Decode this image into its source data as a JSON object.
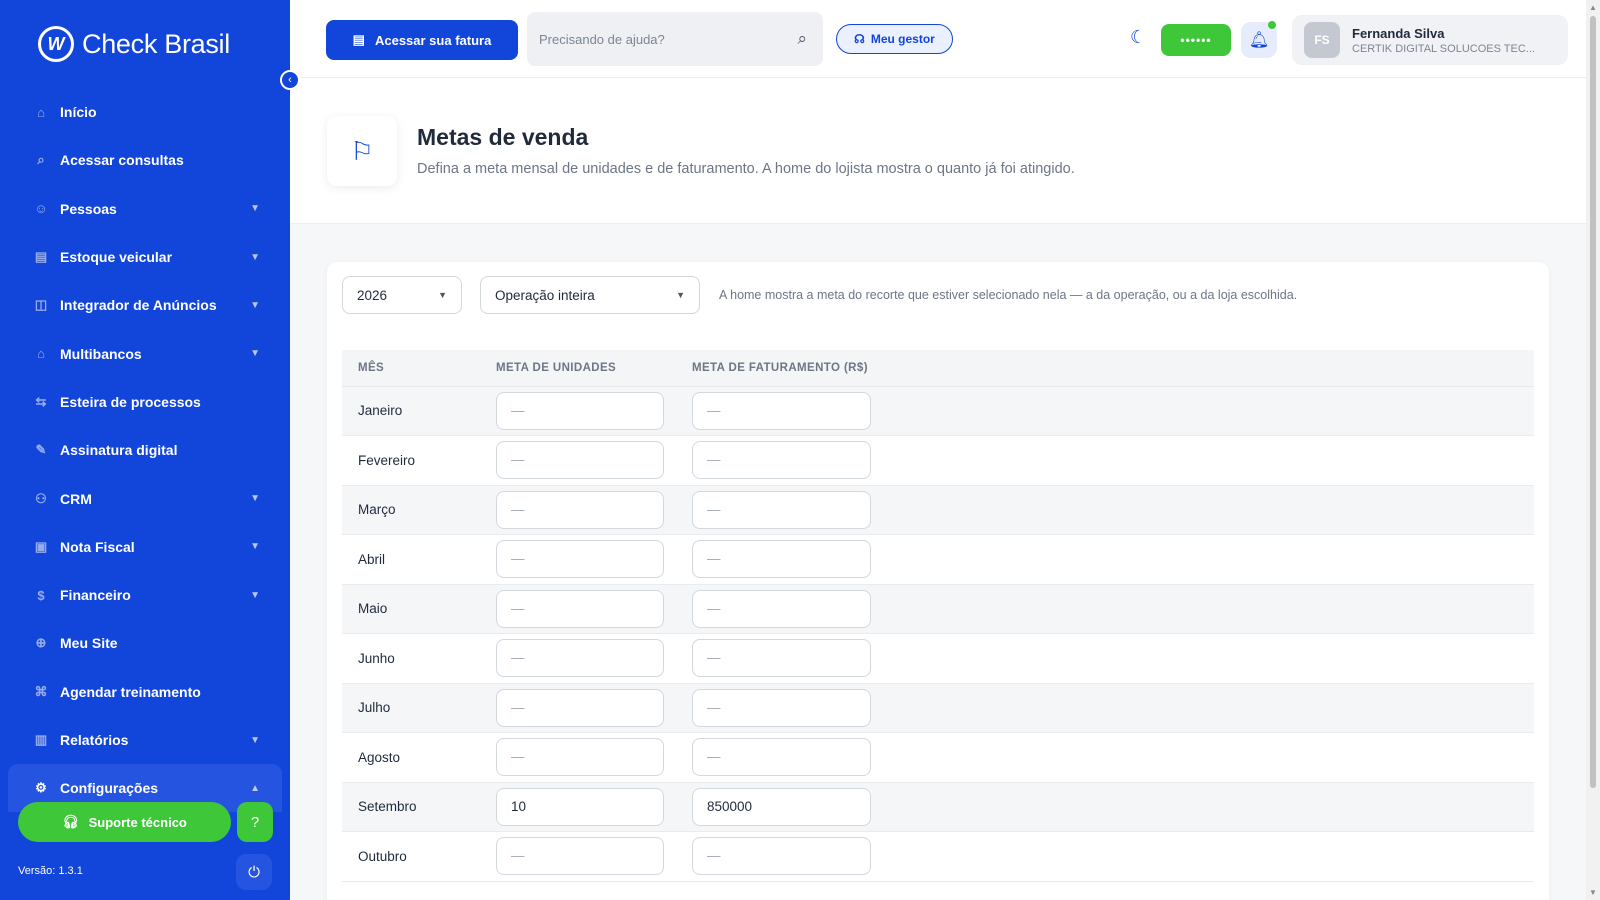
{
  "brand": {
    "logo": "W",
    "name": "Check Brasil"
  },
  "sidebar": {
    "items": [
      {
        "label": "Início",
        "icon": "⌂",
        "icon_name": "home-icon",
        "expandable": false
      },
      {
        "label": "Acessar consultas",
        "icon": "⌕",
        "icon_name": "search-icon",
        "expandable": false
      },
      {
        "label": "Pessoas",
        "icon": "☺",
        "icon_name": "people-icon",
        "expandable": true
      },
      {
        "label": "Estoque veicular",
        "icon": "▤",
        "icon_name": "vehicle-stock-icon",
        "expandable": true
      },
      {
        "label": "Integrador de Anúncios",
        "icon": "◫",
        "icon_name": "ads-integrator-icon",
        "expandable": true
      },
      {
        "label": "Multibancos",
        "icon": "⌂",
        "icon_name": "bank-icon",
        "expandable": true
      },
      {
        "label": "Esteira de processos",
        "icon": "⇆",
        "icon_name": "process-pipeline-icon",
        "expandable": false
      },
      {
        "label": "Assinatura digital",
        "icon": "✎",
        "icon_name": "signature-icon",
        "expandable": false
      },
      {
        "label": "CRM",
        "icon": "⚇",
        "icon_name": "crm-icon",
        "expandable": true
      },
      {
        "label": "Nota Fiscal",
        "icon": "▣",
        "icon_name": "invoice-icon",
        "expandable": true
      },
      {
        "label": "Financeiro",
        "icon": "$",
        "icon_name": "finance-icon",
        "expandable": true
      },
      {
        "label": "Meu Site",
        "icon": "⊕",
        "icon_name": "globe-icon",
        "expandable": false
      },
      {
        "label": "Agendar treinamento",
        "icon": "⌘",
        "icon_name": "training-icon",
        "expandable": false
      },
      {
        "label": "Relatórios",
        "icon": "▥",
        "icon_name": "reports-icon",
        "expandable": true
      },
      {
        "label": "Configurações",
        "icon": "⚙",
        "icon_name": "gear-icon",
        "expandable": true,
        "expanded": true
      }
    ],
    "support_label": "Suporte técnico",
    "version": "Versão: 1.3.1"
  },
  "topbar": {
    "fatura_label": "Acessar sua fatura",
    "help_placeholder": "Precisando de ajuda?",
    "gestor_label": "Meu gestor",
    "masked_value": "••••••",
    "user": {
      "initials": "FS",
      "name": "Fernanda Silva",
      "company": "CERTIK DIGITAL SOLUCOES TEC..."
    }
  },
  "header": {
    "title": "Metas de venda",
    "subtitle": "Defina a meta mensal de unidades e de faturamento. A home do lojista mostra o quanto já foi atingido."
  },
  "filters": {
    "year": "2026",
    "scope": "Operação inteira",
    "note": "A home mostra a meta do recorte que estiver selecionado nela — a da operação, ou a da loja escolhida."
  },
  "table": {
    "headers": {
      "month": "MÊS",
      "units": "META DE UNIDADES",
      "revenue": "META DE FATURAMENTO (R$)"
    },
    "placeholder": "—",
    "rows": [
      {
        "month": "Janeiro",
        "units": "",
        "revenue": ""
      },
      {
        "month": "Fevereiro",
        "units": "",
        "revenue": ""
      },
      {
        "month": "Março",
        "units": "",
        "revenue": ""
      },
      {
        "month": "Abril",
        "units": "",
        "revenue": ""
      },
      {
        "month": "Maio",
        "units": "",
        "revenue": ""
      },
      {
        "month": "Junho",
        "units": "",
        "revenue": ""
      },
      {
        "month": "Julho",
        "units": "",
        "revenue": ""
      },
      {
        "month": "Agosto",
        "units": "",
        "revenue": ""
      },
      {
        "month": "Setembro",
        "units": "10",
        "revenue": "850000"
      },
      {
        "month": "Outubro",
        "units": "",
        "revenue": ""
      }
    ]
  },
  "colors": {
    "primary": "#1245d9",
    "success": "#3fc73a"
  }
}
